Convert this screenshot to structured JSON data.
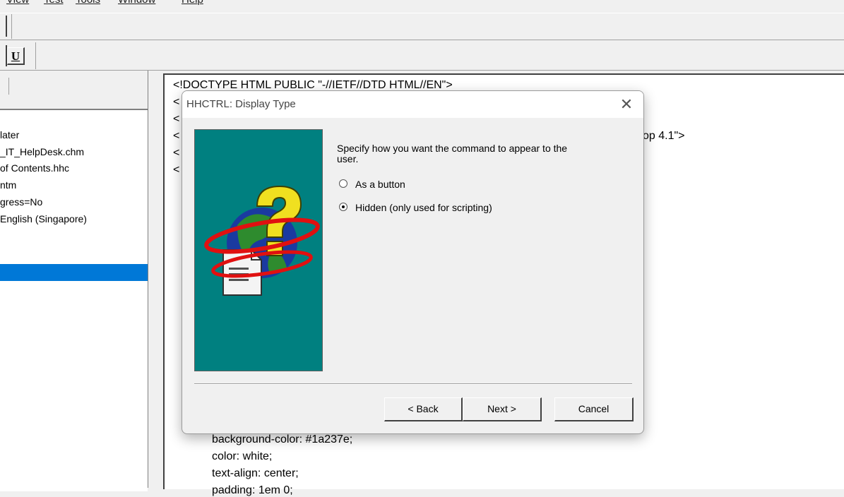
{
  "menubar": {
    "items": [
      "View",
      "Test",
      "Tools",
      "Window",
      "Help"
    ]
  },
  "toolbar": {
    "underline_label": "U"
  },
  "left_panel": {
    "items": [
      "later",
      "_IT_HelpDesk.chm",
      "of Contents.hhc",
      "ntm",
      "gress=No",
      "English (Singapore)"
    ]
  },
  "editor": {
    "lines_top": [
      "<!DOCTYPE HTML PUBLIC \"-//IETF//DTD HTML//EN\">",
      "<",
      "<",
      "<",
      "<",
      "<"
    ],
    "fragment_right": "op 4.1\">",
    "lines_bottom": [
      "background-color: #1a237e;",
      "color: white;",
      "text-align: center;",
      "padding: 1em 0;"
    ]
  },
  "dialog": {
    "title": "HHCTRL: Display Type",
    "prompt": "Specify how you want the command to appear to the user.",
    "options": [
      {
        "label": "As a button",
        "selected": false
      },
      {
        "label": "Hidden (only used for scripting)",
        "selected": true
      }
    ],
    "buttons": {
      "back": "< Back",
      "next": "Next >",
      "cancel": "Cancel"
    }
  },
  "colors": {
    "selection": "#0078d7",
    "wizard_panel": "#008080",
    "window_bg": "#f0f0f0"
  },
  "icons": [
    "close-icon",
    "help-wizard-icon",
    "radio-button"
  ]
}
